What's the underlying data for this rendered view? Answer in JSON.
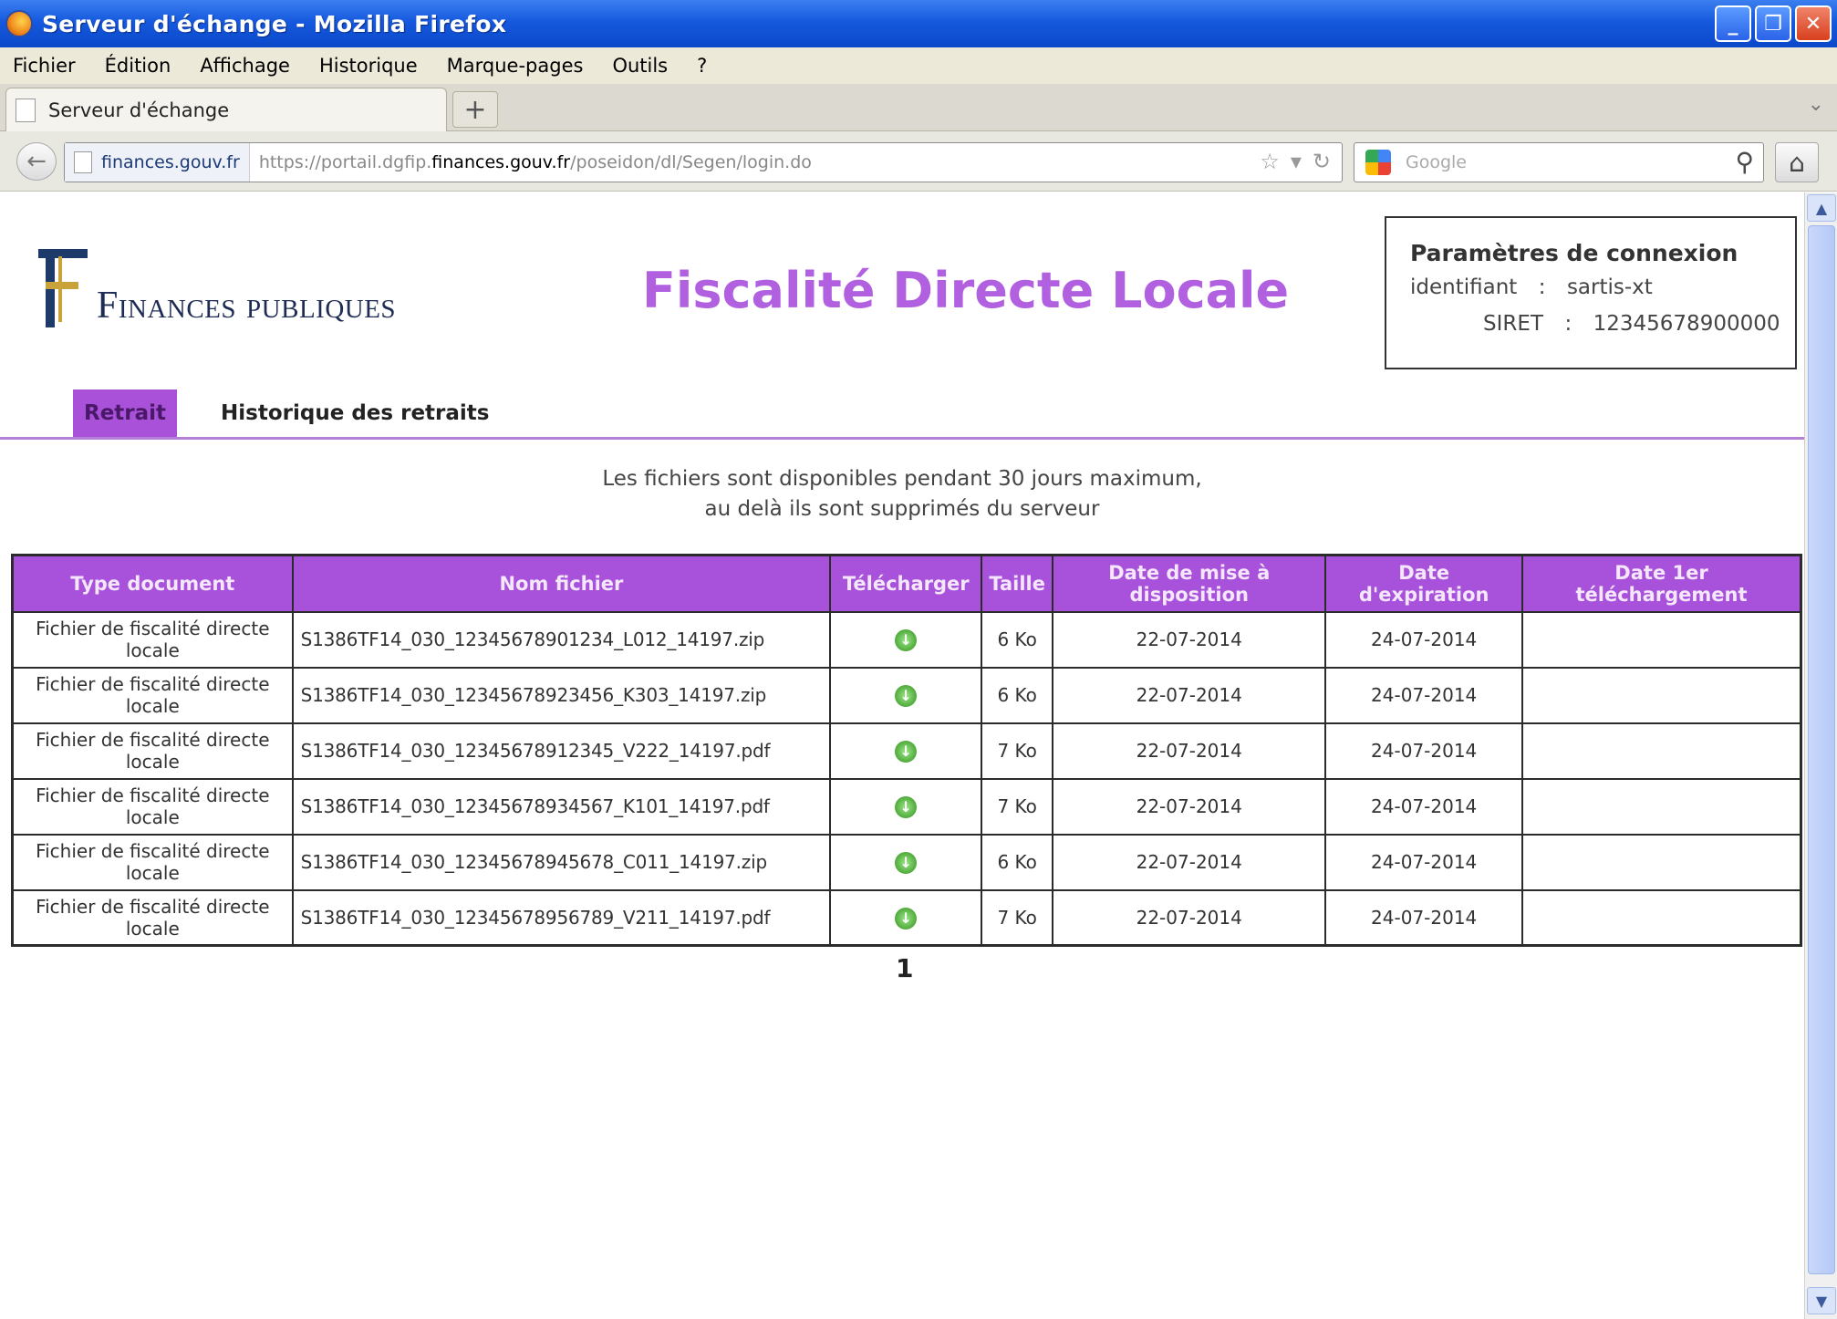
{
  "window": {
    "title": "Serveur d'échange - Mozilla Firefox",
    "min_label": "_",
    "max_label": "❐",
    "close_label": "✕"
  },
  "menu": [
    "Fichier",
    "Édition",
    "Affichage",
    "Historique",
    "Marque-pages",
    "Outils",
    "?"
  ],
  "tab": {
    "title": "Serveur d'échange",
    "new_tab_label": "+",
    "dropdown_label": "⌄"
  },
  "nav": {
    "site_identity": "finances.gouv.fr",
    "url_prefix": "https://portail.dgfip.",
    "url_domain": "finances.gouv.fr",
    "url_suffix": "/poseidon/dl/Segen/login.do",
    "search_placeholder": "Google"
  },
  "logo": {
    "text": "Finances publiques"
  },
  "app": {
    "title": "Fiscalité Directe Locale"
  },
  "connection": {
    "title": "Paramètres de connexion",
    "id_label": "identifiant",
    "id_value": "sartis-xt",
    "siret_label": "SIRET",
    "siret_value": "12345678900000",
    "separator": ":"
  },
  "tabs": {
    "active": "Retrait",
    "other": "Historique des retraits"
  },
  "notice": {
    "line1": "Les fichiers sont disponibles pendant 30 jours maximum,",
    "line2": "au delà ils sont supprimés du serveur"
  },
  "table": {
    "headers": [
      "Type document",
      "Nom fichier",
      "Télécharger",
      "Taille",
      "Date de mise à disposition",
      "Date d'expiration",
      "Date 1er téléchargement"
    ],
    "rows": [
      {
        "type": "Fichier de fiscalité directe locale",
        "file": "S1386TF14_030_12345678901234_L012_14197.zip",
        "size": "6 Ko",
        "available": "22-07-2014",
        "expiration": "24-07-2014",
        "first_download": ""
      },
      {
        "type": "Fichier de fiscalité directe locale",
        "file": "S1386TF14_030_12345678923456_K303_14197.zip",
        "size": "6 Ko",
        "available": "22-07-2014",
        "expiration": "24-07-2014",
        "first_download": ""
      },
      {
        "type": "Fichier de fiscalité directe locale",
        "file": "S1386TF14_030_12345678912345_V222_14197.pdf",
        "size": "7 Ko",
        "available": "22-07-2014",
        "expiration": "24-07-2014",
        "first_download": ""
      },
      {
        "type": "Fichier de fiscalité directe locale",
        "file": "S1386TF14_030_12345678934567_K101_14197.pdf",
        "size": "7 Ko",
        "available": "22-07-2014",
        "expiration": "24-07-2014",
        "first_download": ""
      },
      {
        "type": "Fichier de fiscalité directe locale",
        "file": "S1386TF14_030_12345678945678_C011_14197.zip",
        "size": "6 Ko",
        "available": "22-07-2014",
        "expiration": "24-07-2014",
        "first_download": ""
      },
      {
        "type": "Fichier de fiscalité directe locale",
        "file": "S1386TF14_030_12345678956789_V211_14197.pdf",
        "size": "7 Ko",
        "available": "22-07-2014",
        "expiration": "24-07-2014",
        "first_download": ""
      }
    ]
  },
  "pagination": {
    "current": "1"
  },
  "colors": {
    "accent": "#a851da",
    "title_color": "#b161df"
  }
}
